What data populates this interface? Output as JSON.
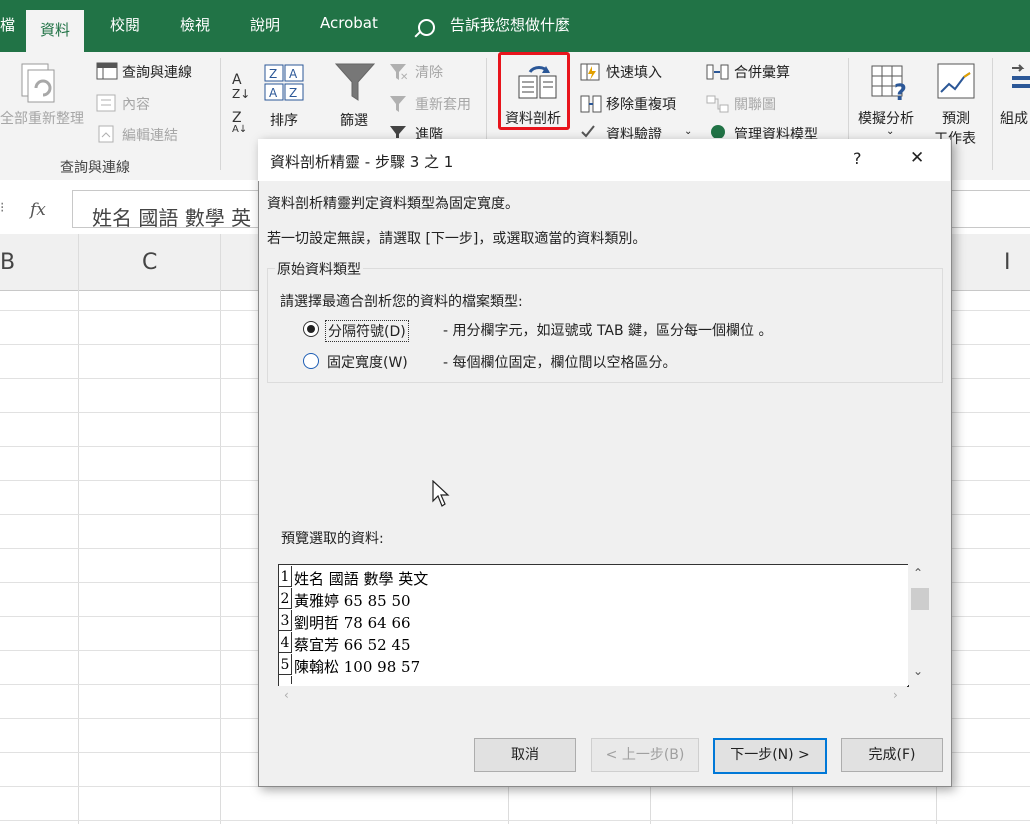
{
  "ribbon_tabs": [
    {
      "label": "資料",
      "active": true
    },
    {
      "label": "校閱"
    },
    {
      "label": "檢視"
    },
    {
      "label": "說明"
    },
    {
      "label": "Acrobat"
    }
  ],
  "tell_me": "告訴我您想做什麼",
  "ribbon": {
    "group_query": {
      "refresh_all": "全部重新整理",
      "queries_connections": "查詢與連線",
      "properties": "內容",
      "edit_links": "編輯連結",
      "group_label": "查詢與連線"
    },
    "sort": "排序",
    "filter": "篩選",
    "clear": "清除",
    "reapply": "重新套用",
    "advanced": "進階",
    "text_to_columns": "資料剖析",
    "flash_fill": "快速填入",
    "remove_duplicates": "移除重複項",
    "data_validation": "資料驗證",
    "consolidate": "合併彙算",
    "relationships": "關聯圖",
    "manage_data_model": "管理資料模型",
    "what_if": "模擬分析",
    "forecast_line1": "預測",
    "forecast_line2": "工作表",
    "group": "組成"
  },
  "formula_bar": {
    "fx": "fx",
    "content": "姓名 國語 數學 英"
  },
  "columns": [
    "B",
    "C",
    "I"
  ],
  "dialog": {
    "title": "資料剖析精靈 - 步驟 3 之 1",
    "help": "?",
    "close": "✕",
    "line1": "資料剖析精靈判定資料類型為固定寬度。",
    "line2": "若一切設定無誤，請選取 [下一步]，或選取適當的資料類別。",
    "group_title": "原始資料類型",
    "group_prompt": "請選擇最適合剖析您的資料的檔案類型:",
    "options": [
      {
        "label": "分隔符號(D)",
        "desc": "- 用分欄字元，如逗號或 TAB 鍵，區分每一個欄位 。",
        "selected": true
      },
      {
        "label": "固定寬度(W)",
        "desc": "- 每個欄位固定，欄位間以空格區分。",
        "selected": false
      }
    ],
    "preview_label": "預覽選取的資料:",
    "preview_rows": [
      {
        "num": "1",
        "text": "姓名 國語 數學 英文"
      },
      {
        "num": "2",
        "text": "黃雅婷 65 85 50"
      },
      {
        "num": "3",
        "text": "劉明哲 78 64 66"
      },
      {
        "num": "4",
        "text": "蔡宜芳 66 52 45"
      },
      {
        "num": "5",
        "text": "陳翰松 100 98 57"
      }
    ],
    "buttons": {
      "cancel": "取消",
      "back": "< 上一步(B)",
      "next": "下一步(N) >",
      "finish": "完成(F)"
    }
  },
  "colors": {
    "ribbon_green": "#217346",
    "highlight_red": "#e8141c",
    "focus_blue": "#0078d7"
  }
}
